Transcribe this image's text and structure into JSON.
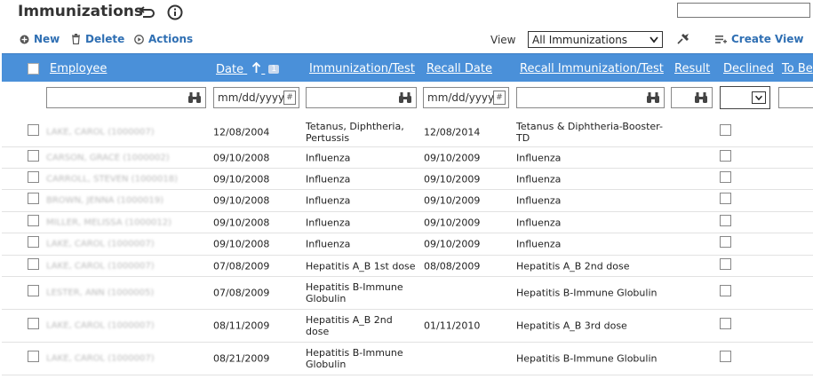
{
  "page": {
    "title": "Immunizations"
  },
  "toolbar": {
    "new_label": "New",
    "delete_label": "Delete",
    "actions_label": "Actions",
    "view_label": "View",
    "view_selected": "All Immunizations",
    "create_view_label": "Create View"
  },
  "columns": {
    "employee": "Employee",
    "date": "Date",
    "date_sort_order": "1",
    "immunization": "Immunization/Test",
    "recall_date": "Recall Date",
    "recall_immunization": "Recall Immunization/Test",
    "result": "Result",
    "declined": "Declined",
    "to_be": "To Be"
  },
  "filters": {
    "date_placeholder": "mm/dd/yyyy",
    "recall_date_placeholder": "mm/dd/yyyy"
  },
  "rows": [
    {
      "employee": "LAKE, CAROL (1000007)",
      "date": "12/08/2004",
      "immunization": "Tetanus, Diphtheria, Pertussis",
      "recall_date": "12/08/2014",
      "recall_immunization": "Tetanus & Diphtheria-Booster-TD"
    },
    {
      "employee": "CARSON, GRACE (1000002)",
      "date": "09/10/2008",
      "immunization": "Influenza",
      "recall_date": "09/10/2009",
      "recall_immunization": "Influenza"
    },
    {
      "employee": "CARROLL, STEVEN (1000018)",
      "date": "09/10/2008",
      "immunization": "Influenza",
      "recall_date": "09/10/2009",
      "recall_immunization": "Influenza"
    },
    {
      "employee": "BROWN, JENNA (1000019)",
      "date": "09/10/2008",
      "immunization": "Influenza",
      "recall_date": "09/10/2009",
      "recall_immunization": "Influenza"
    },
    {
      "employee": "MILLER, MELISSA (1000012)",
      "date": "09/10/2008",
      "immunization": "Influenza",
      "recall_date": "09/10/2009",
      "recall_immunization": "Influenza"
    },
    {
      "employee": "LAKE, CAROL (1000007)",
      "date": "09/10/2008",
      "immunization": "Influenza",
      "recall_date": "09/10/2009",
      "recall_immunization": "Influenza"
    },
    {
      "employee": "LAKE, CAROL (1000007)",
      "date": "07/08/2009",
      "immunization": "Hepatitis A_B 1st dose",
      "recall_date": "08/08/2009",
      "recall_immunization": "Hepatitis A_B 2nd dose"
    },
    {
      "employee": "LESTER, ANN (1000005)",
      "date": "07/08/2009",
      "immunization": "Hepatitis B-Immune Globulin",
      "recall_date": "",
      "recall_immunization": "Hepatitis B-Immune Globulin"
    },
    {
      "employee": "LAKE, CAROL (1000007)",
      "date": "08/11/2009",
      "immunization": "Hepatitis A_B 2nd dose",
      "recall_date": "01/11/2010",
      "recall_immunization": "Hepatitis A_B 3rd dose"
    },
    {
      "employee": "LAKE, CAROL (1000007)",
      "date": "08/21/2009",
      "immunization": "Hepatitis B-Immune Globulin",
      "recall_date": "",
      "recall_immunization": "Hepatitis B-Immune Globulin"
    }
  ]
}
